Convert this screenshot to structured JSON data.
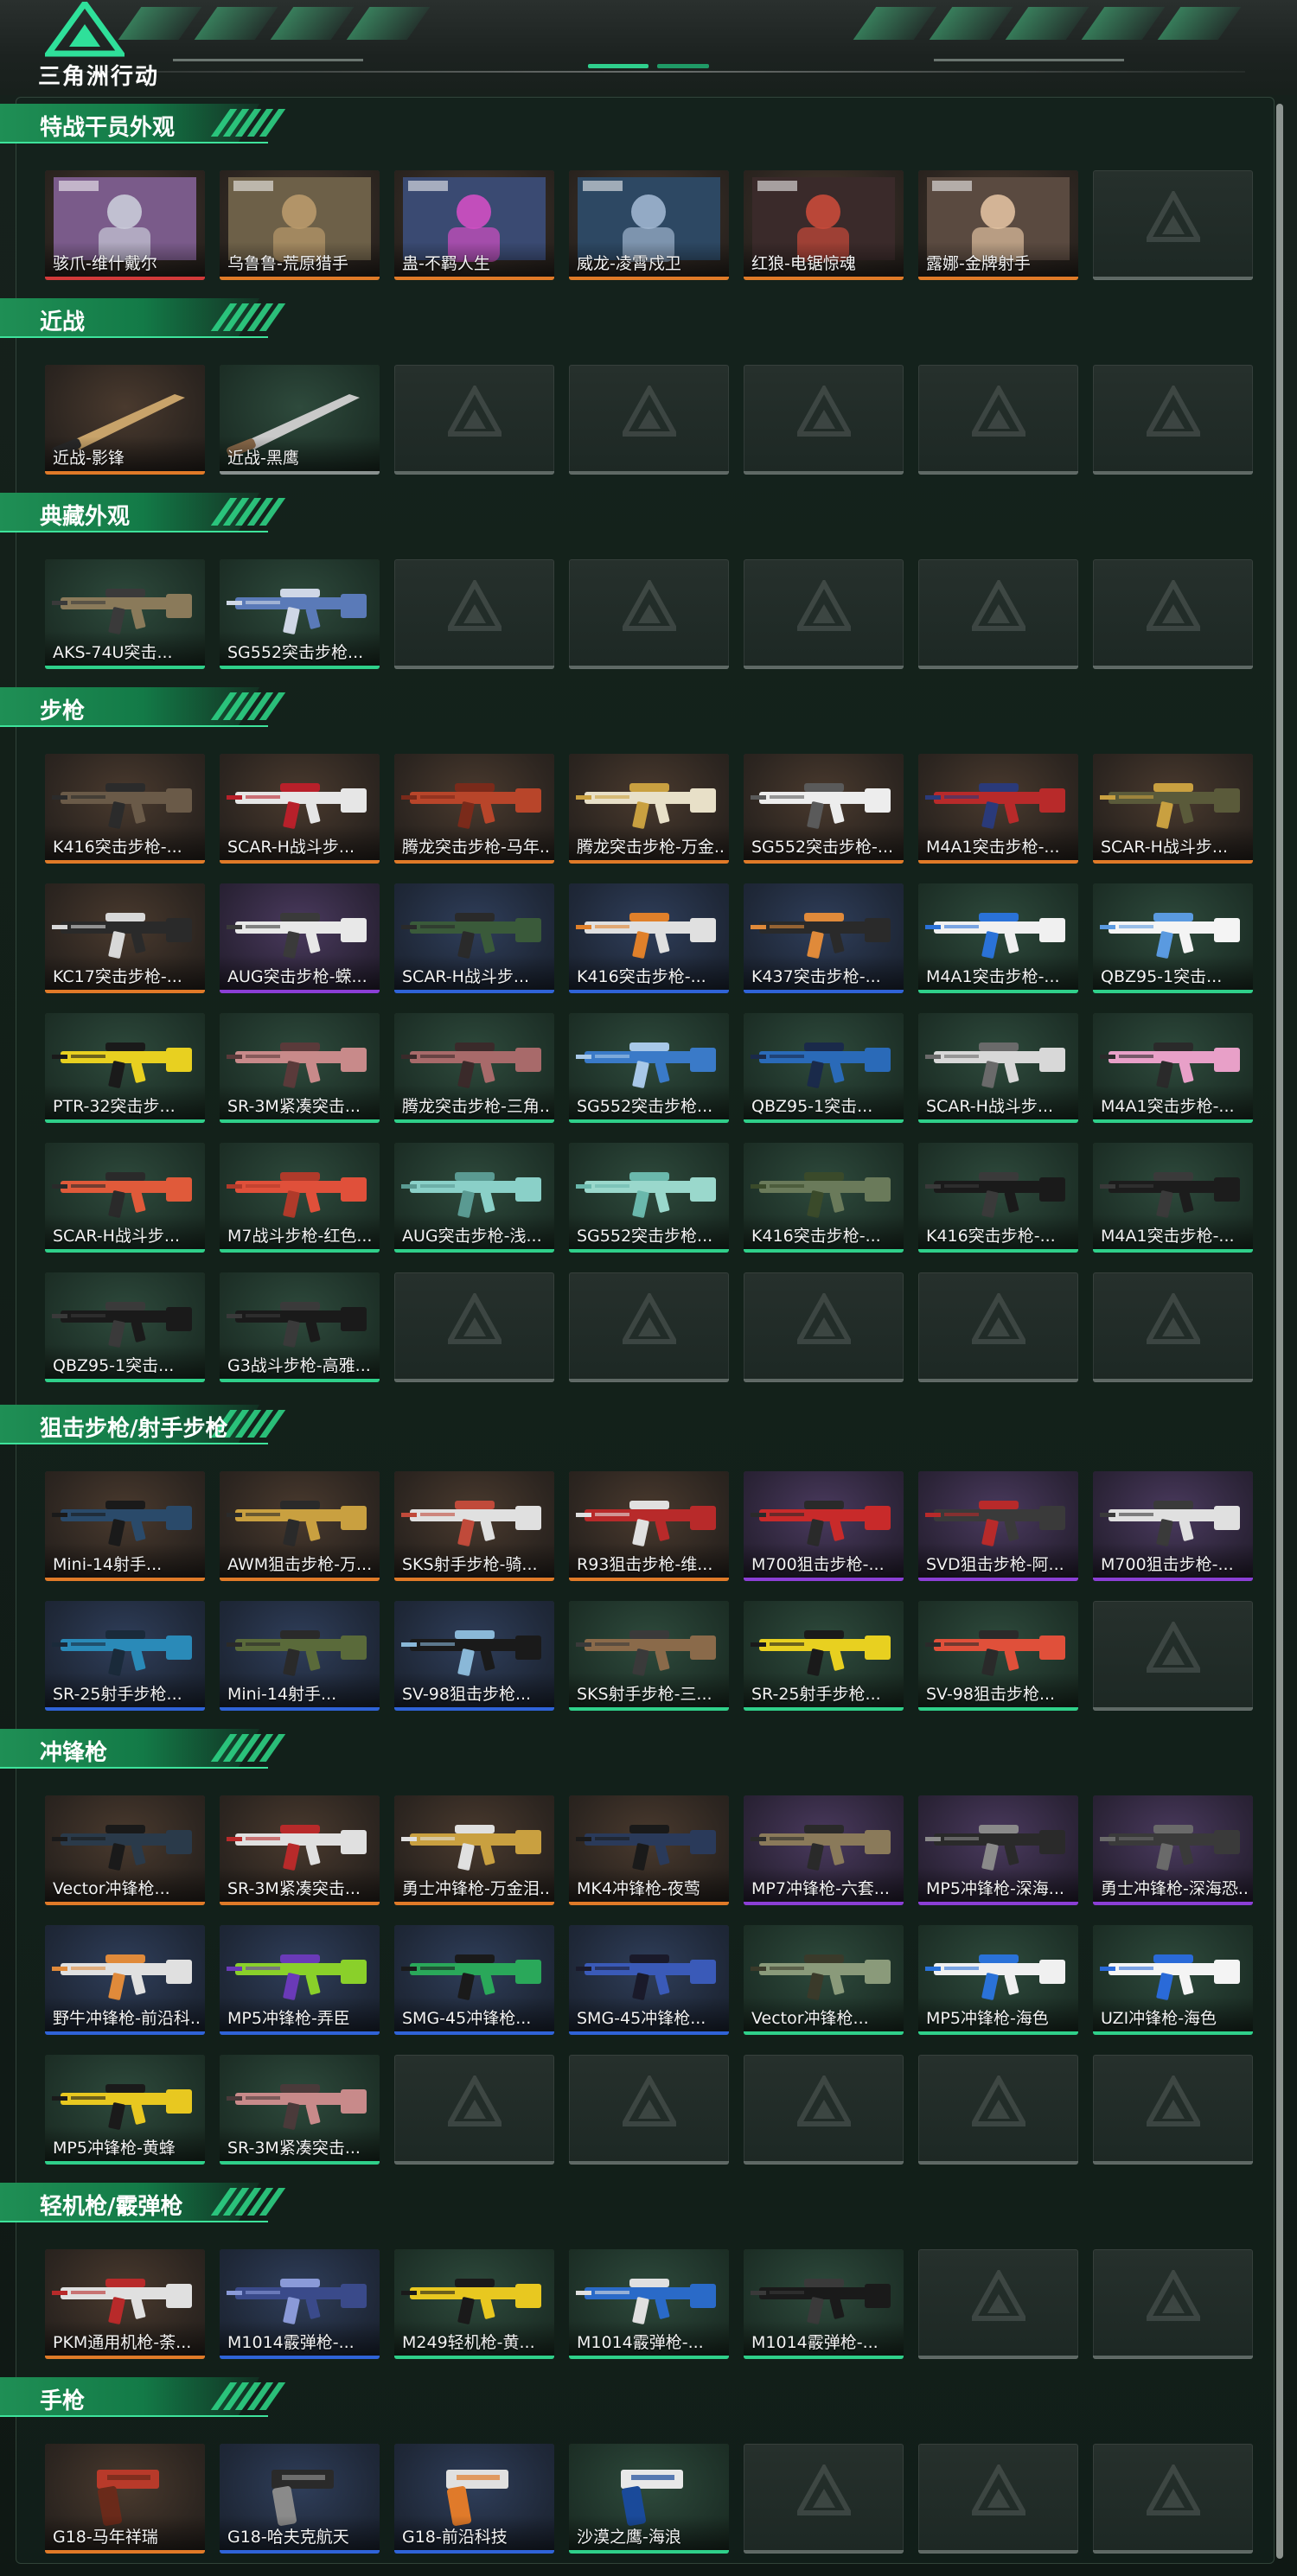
{
  "app": {
    "title": "三角洲行动"
  },
  "sections": [
    {
      "title": "特战干员外观",
      "items": [
        {
          "name": "骇爪-维什戴尔",
          "q": "red",
          "kind": "portrait",
          "c1": "#7a5b8a",
          "c2": "#c9cbd8"
        },
        {
          "name": "乌鲁鲁-荒原猎手",
          "q": "orange",
          "kind": "portrait",
          "c1": "#6d6048",
          "c2": "#b99a6b"
        },
        {
          "name": "蛊-不羁人生",
          "q": "orange",
          "kind": "portrait",
          "c1": "#3a4a72",
          "c2": "#d14fc3"
        },
        {
          "name": "威龙-凌霄戍卫",
          "q": "orange",
          "kind": "portrait",
          "c1": "#2d4863",
          "c2": "#9fb5cf"
        },
        {
          "name": "红狼-电锯惊魂",
          "q": "orange",
          "kind": "portrait",
          "c1": "#3a2a2a",
          "c2": "#c94a3a"
        },
        {
          "name": "露娜-金牌射手",
          "q": "orange",
          "kind": "portrait",
          "c1": "#5a4a40",
          "c2": "#e0c0a0"
        },
        {
          "name": "",
          "q": "empty"
        }
      ]
    },
    {
      "title": "近战",
      "items": [
        {
          "name": "近战-影锋",
          "q": "orange",
          "kind": "knife",
          "c1": "#c8a36a",
          "c2": "#2a2a2a"
        },
        {
          "name": "近战-黑鹰",
          "q": "gray",
          "kind": "knife",
          "c1": "#c9c9c9",
          "c2": "#8a6a4a"
        },
        {
          "name": "",
          "q": "empty"
        },
        {
          "name": "",
          "q": "empty"
        },
        {
          "name": "",
          "q": "empty"
        },
        {
          "name": "",
          "q": "empty"
        },
        {
          "name": "",
          "q": "empty"
        }
      ]
    },
    {
      "title": "典藏外观",
      "items": [
        {
          "name": "AKS-74U突击...",
          "q": "green",
          "kind": "gun",
          "c1": "#8a7a5a",
          "c2": "#3a3a3a"
        },
        {
          "name": "SG552突击步枪...",
          "q": "green",
          "kind": "gun",
          "c1": "#5a7ab8",
          "c2": "#cfd7e6"
        },
        {
          "name": "",
          "q": "empty"
        },
        {
          "name": "",
          "q": "empty"
        },
        {
          "name": "",
          "q": "empty"
        },
        {
          "name": "",
          "q": "empty"
        },
        {
          "name": "",
          "q": "empty"
        }
      ]
    },
    {
      "title": "步枪",
      "items": [
        {
          "name": "K416突击步枪-...",
          "q": "orange",
          "kind": "gun",
          "c1": "#6a5a48",
          "c2": "#2b2b2b"
        },
        {
          "name": "SCAR-H战斗步...",
          "q": "orange",
          "kind": "gun",
          "c1": "#e6e6e6",
          "c2": "#b8202a"
        },
        {
          "name": "腾龙突击步枪-马年...",
          "q": "orange",
          "kind": "gun",
          "c1": "#b8452a",
          "c2": "#7a2a1a"
        },
        {
          "name": "腾龙突击步枪-万金...",
          "q": "orange",
          "kind": "gun",
          "c1": "#e8e0c8",
          "c2": "#c9a040"
        },
        {
          "name": "SG552突击步枪-...",
          "q": "orange",
          "kind": "gun",
          "c1": "#ededed",
          "c2": "#5a5a5a"
        },
        {
          "name": "M4A1突击步枪-...",
          "q": "orange",
          "kind": "gun",
          "c1": "#b82a2a",
          "c2": "#2a3a7a"
        },
        {
          "name": "SCAR-H战斗步...",
          "q": "orange",
          "kind": "gun",
          "c1": "#5a5a3a",
          "c2": "#c9a040"
        },
        {
          "name": "KC17突击步枪-...",
          "q": "orange",
          "kind": "gun",
          "c1": "#2a2a2a",
          "c2": "#d8d8d8"
        },
        {
          "name": "AUG突击步枪-蝾...",
          "q": "purple",
          "kind": "gun",
          "c1": "#e8e8e8",
          "c2": "#3a3a3a"
        },
        {
          "name": "SCAR-H战斗步...",
          "q": "blue",
          "kind": "gun",
          "c1": "#3a5a3a",
          "c2": "#2a2a2a"
        },
        {
          "name": "K416突击步枪-...",
          "q": "blue",
          "kind": "gun",
          "c1": "#e0e0e0",
          "c2": "#e0802a"
        },
        {
          "name": "K437突击步枪-...",
          "q": "blue",
          "kind": "gun",
          "c1": "#2a2a2a",
          "c2": "#e08a3a"
        },
        {
          "name": "M4A1突击步枪-...",
          "q": "green",
          "kind": "gun",
          "c1": "#f0f0f0",
          "c2": "#2a72d8"
        },
        {
          "name": "QBZ95-1突击...",
          "q": "green",
          "kind": "gun",
          "c1": "#f4f4f4",
          "c2": "#5a9ae0"
        },
        {
          "name": "PTR-32突击步...",
          "q": "green",
          "kind": "gun",
          "c1": "#e8d020",
          "c2": "#1a1a1a"
        },
        {
          "name": "SR-3M紧凑突击...",
          "q": "green",
          "kind": "gun",
          "c1": "#c88a8a",
          "c2": "#5a3a3a"
        },
        {
          "name": "腾龙突击步枪-三角...",
          "q": "green",
          "kind": "gun",
          "c1": "#a86a6a",
          "c2": "#3a2a2a"
        },
        {
          "name": "SG552突击步枪...",
          "q": "green",
          "kind": "gun",
          "c1": "#3a7ac8",
          "c2": "#a8c8e8"
        },
        {
          "name": "QBZ95-1突击...",
          "q": "green",
          "kind": "gun",
          "c1": "#2a6ab8",
          "c2": "#1a2a4a"
        },
        {
          "name": "SCAR-H战斗步...",
          "q": "green",
          "kind": "gun",
          "c1": "#d8d8d8",
          "c2": "#6a6a6a"
        },
        {
          "name": "M4A1突击步枪-...",
          "q": "green",
          "kind": "gun",
          "c1": "#e8a0c8",
          "c2": "#2a2a2a"
        },
        {
          "name": "SCAR-H战斗步...",
          "q": "green",
          "kind": "gun",
          "c1": "#e05a3a",
          "c2": "#2a2a2a"
        },
        {
          "name": "M7战斗步枪-红色...",
          "q": "green",
          "kind": "gun",
          "c1": "#e0503a",
          "c2": "#b03a2a"
        },
        {
          "name": "AUG突击步枪-浅...",
          "q": "green",
          "kind": "gun",
          "c1": "#8ad0c8",
          "c2": "#5a9a92"
        },
        {
          "name": "SG552突击步枪...",
          "q": "green",
          "kind": "gun",
          "c1": "#9ad8cc",
          "c2": "#6ab8ac"
        },
        {
          "name": "K416突击步枪-...",
          "q": "green",
          "kind": "gun",
          "c1": "#6a7a5a",
          "c2": "#3a4a2a"
        },
        {
          "name": "K416突击步枪-...",
          "q": "green",
          "kind": "gun",
          "c1": "#1a1a1a",
          "c2": "#3a3a3a"
        },
        {
          "name": "M4A1突击步枪-...",
          "q": "green",
          "kind": "gun",
          "c1": "#1c1c1c",
          "c2": "#3a3a3a"
        },
        {
          "name": "QBZ95-1突击...",
          "q": "green",
          "kind": "gun",
          "c1": "#1a1a1a",
          "c2": "#3a3a3a"
        },
        {
          "name": "G3战斗步枪-高雅...",
          "q": "green",
          "kind": "gun",
          "c1": "#1a1a1a",
          "c2": "#3a3a3a"
        },
        {
          "name": "",
          "q": "empty"
        },
        {
          "name": "",
          "q": "empty"
        },
        {
          "name": "",
          "q": "empty"
        },
        {
          "name": "",
          "q": "empty"
        },
        {
          "name": "",
          "q": "empty"
        }
      ]
    },
    {
      "title": "狙击步枪/射手步枪",
      "items": [
        {
          "name": "Mini-14射手...",
          "q": "orange",
          "kind": "gun",
          "c1": "#2a4a6a",
          "c2": "#1a1a1a"
        },
        {
          "name": "AWM狙击步枪-万...",
          "q": "orange",
          "kind": "gun",
          "c1": "#c9a040",
          "c2": "#2a2a2a"
        },
        {
          "name": "SKS射手步枪-骑...",
          "q": "orange",
          "kind": "gun",
          "c1": "#e0e0e0",
          "c2": "#c04a3a"
        },
        {
          "name": "R93狙击步枪-维...",
          "q": "orange",
          "kind": "gun",
          "c1": "#b82a2a",
          "c2": "#e0e0e0"
        },
        {
          "name": "M700狙击步枪-...",
          "q": "purple",
          "kind": "gun",
          "c1": "#c82a2a",
          "c2": "#2a2a2a"
        },
        {
          "name": "SVD狙击步枪-阿...",
          "q": "purple",
          "kind": "gun",
          "c1": "#3a3a3a",
          "c2": "#b82a2a"
        },
        {
          "name": "M700狙击步枪-...",
          "q": "purple",
          "kind": "gun",
          "c1": "#e0e0e0",
          "c2": "#3a3a3a"
        },
        {
          "name": "SR-25射手步枪...",
          "q": "blue",
          "kind": "gun",
          "c1": "#2a8ab8",
          "c2": "#1a2a3a"
        },
        {
          "name": "Mini-14射手...",
          "q": "blue",
          "kind": "gun",
          "c1": "#5a6a3a",
          "c2": "#2a2a2a"
        },
        {
          "name": "SV-98狙击步枪...",
          "q": "blue",
          "kind": "gun",
          "c1": "#1a1a1a",
          "c2": "#8ab8d8"
        },
        {
          "name": "SKS射手步枪-三...",
          "q": "green",
          "kind": "gun",
          "c1": "#8a6a4a",
          "c2": "#3a3a3a"
        },
        {
          "name": "SR-25射手步枪...",
          "q": "green",
          "kind": "gun",
          "c1": "#e8d020",
          "c2": "#1a1a1a"
        },
        {
          "name": "SV-98狙击步枪...",
          "q": "green",
          "kind": "gun",
          "c1": "#e0503a",
          "c2": "#2a2a2a"
        },
        {
          "name": "",
          "q": "empty"
        }
      ]
    },
    {
      "title": "冲锋枪",
      "items": [
        {
          "name": "Vector冲锋枪...",
          "q": "orange",
          "kind": "gun",
          "c1": "#2a3a4a",
          "c2": "#1a1a1a"
        },
        {
          "name": "SR-3M紧凑突击...",
          "q": "orange",
          "kind": "gun",
          "c1": "#e0e0e0",
          "c2": "#b82a2a"
        },
        {
          "name": "勇士冲锋枪-万金泪...",
          "q": "orange",
          "kind": "gun",
          "c1": "#c9a040",
          "c2": "#e0e0e0"
        },
        {
          "name": "MK4冲锋枪-夜莺",
          "q": "orange",
          "kind": "gun",
          "c1": "#2a3a5a",
          "c2": "#1a1a1a"
        },
        {
          "name": "MP7冲锋枪-六套...",
          "q": "purple",
          "kind": "gun",
          "c1": "#8a7a5a",
          "c2": "#2a2a2a"
        },
        {
          "name": "MP5冲锋枪-深海...",
          "q": "purple",
          "kind": "gun",
          "c1": "#2a2a2a",
          "c2": "#8a8a8a"
        },
        {
          "name": "勇士冲锋枪-深海恐...",
          "q": "purple",
          "kind": "gun",
          "c1": "#3a3a3a",
          "c2": "#6a6a6a"
        },
        {
          "name": "野牛冲锋枪-前沿科...",
          "q": "blue",
          "kind": "gun",
          "c1": "#e0e0e0",
          "c2": "#e08a3a"
        },
        {
          "name": "MP5冲锋枪-弄臣",
          "q": "blue",
          "kind": "gun",
          "c1": "#8ad02a",
          "c2": "#6a3ab8"
        },
        {
          "name": "SMG-45冲锋枪...",
          "q": "blue",
          "kind": "gun",
          "c1": "#2aa85a",
          "c2": "#1a1a1a"
        },
        {
          "name": "SMG-45冲锋枪...",
          "q": "blue",
          "kind": "gun",
          "c1": "#3a5ab8",
          "c2": "#1a1a2a"
        },
        {
          "name": "Vector冲锋枪...",
          "q": "green",
          "kind": "gun",
          "c1": "#8a9a7a",
          "c2": "#3a3a2a"
        },
        {
          "name": "MP5冲锋枪-海色",
          "q": "green",
          "kind": "gun",
          "c1": "#f0f0f0",
          "c2": "#2a72d8"
        },
        {
          "name": "UZI冲锋枪-海色",
          "q": "green",
          "kind": "gun",
          "c1": "#f4f4f4",
          "c2": "#2a6ad8"
        },
        {
          "name": "MP5冲锋枪-黄蜂",
          "q": "green",
          "kind": "gun",
          "c1": "#e8c820",
          "c2": "#1a1a1a"
        },
        {
          "name": "SR-3M紧凑突击...",
          "q": "green",
          "kind": "gun",
          "c1": "#c88a8a",
          "c2": "#4a3a3a"
        },
        {
          "name": "",
          "q": "empty"
        },
        {
          "name": "",
          "q": "empty"
        },
        {
          "name": "",
          "q": "empty"
        },
        {
          "name": "",
          "q": "empty"
        },
        {
          "name": "",
          "q": "empty"
        }
      ]
    },
    {
      "title": "轻机枪/霰弹枪",
      "items": [
        {
          "name": "PKM通用机枪-荼...",
          "q": "orange",
          "kind": "gun",
          "c1": "#e0e0e0",
          "c2": "#b82a2a"
        },
        {
          "name": "M1014霰弹枪-...",
          "q": "blue",
          "kind": "gun",
          "c1": "#3a4a8a",
          "c2": "#8a9ad8"
        },
        {
          "name": "M249轻机枪-黄...",
          "q": "green",
          "kind": "gun",
          "c1": "#e8c820",
          "c2": "#1a1a1a"
        },
        {
          "name": "M1014霰弹枪-...",
          "q": "green",
          "kind": "gun",
          "c1": "#2a6ac8",
          "c2": "#e0e0e0"
        },
        {
          "name": "M1014霰弹枪-...",
          "q": "green",
          "kind": "gun",
          "c1": "#1a1a1a",
          "c2": "#3a3a3a"
        },
        {
          "name": "",
          "q": "empty"
        },
        {
          "name": "",
          "q": "empty"
        }
      ]
    },
    {
      "title": "手枪",
      "items": [
        {
          "name": "G18-马年祥瑞",
          "q": "orange",
          "kind": "pistol",
          "c1": "#b83a2a",
          "c2": "#6a2a1a"
        },
        {
          "name": "G18-哈夫克航天",
          "q": "blue",
          "kind": "pistol",
          "c1": "#2a2a2a",
          "c2": "#8a8a8a"
        },
        {
          "name": "G18-前沿科技",
          "q": "blue",
          "kind": "pistol",
          "c1": "#e0e0e0",
          "c2": "#e07a2a"
        },
        {
          "name": "沙漠之鹰-海浪",
          "q": "green",
          "kind": "pistol",
          "c1": "#e8e8e8",
          "c2": "#1a4a9a"
        },
        {
          "name": "",
          "q": "empty"
        },
        {
          "name": "",
          "q": "empty"
        },
        {
          "name": "",
          "q": "empty"
        }
      ]
    }
  ]
}
